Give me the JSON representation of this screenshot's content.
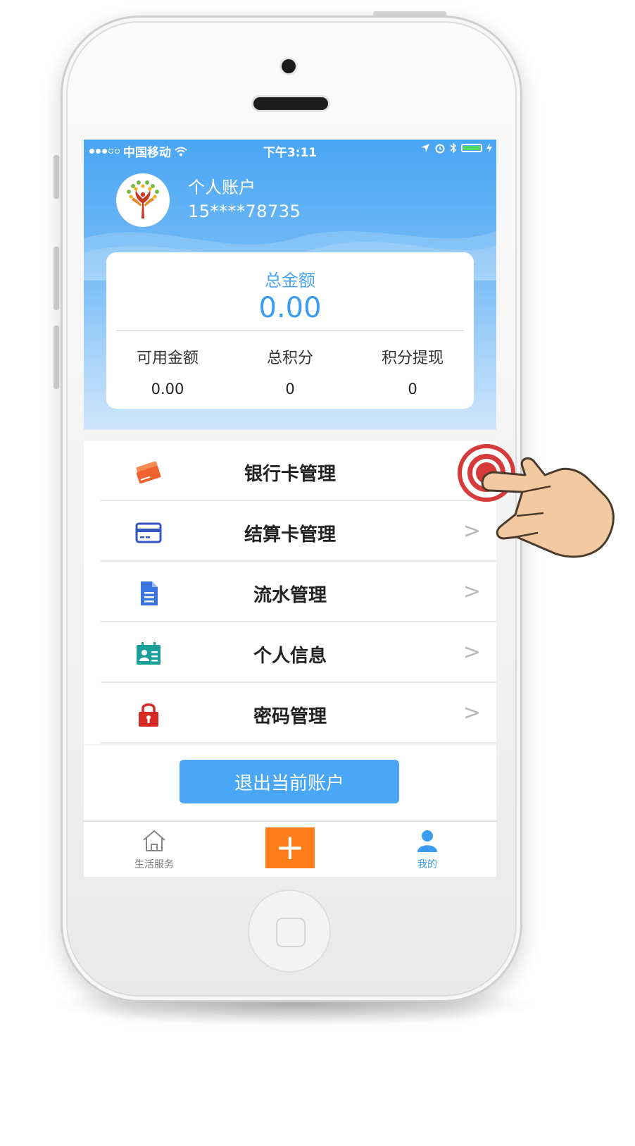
{
  "status_bar": {
    "carrier": "中国移动",
    "time": "下午3:11"
  },
  "account": {
    "title": "个人账户",
    "phone": "15****78735"
  },
  "balance": {
    "total_label": "总金额",
    "total_value": "0.00",
    "stats": [
      {
        "label": "可用金额",
        "value": "0.00"
      },
      {
        "label": "总积分",
        "value": "0"
      },
      {
        "label": "积分提现",
        "value": "0"
      }
    ]
  },
  "menu": {
    "items": [
      {
        "label": "银行卡管理",
        "icon": "bank-card-icon",
        "color": "#f0632e"
      },
      {
        "label": "结算卡管理",
        "icon": "credit-card-icon",
        "color": "#3557c4"
      },
      {
        "label": "流水管理",
        "icon": "document-icon",
        "color": "#3a75e0"
      },
      {
        "label": "个人信息",
        "icon": "id-card-icon",
        "color": "#1a9e9a"
      },
      {
        "label": "密码管理",
        "icon": "lock-icon",
        "color": "#d62b25"
      }
    ],
    "chevron": ">"
  },
  "logout": {
    "label": "退出当前账户"
  },
  "tabbar": {
    "home_label": "生活服务",
    "plus": "+",
    "me_label": "我的"
  },
  "colors": {
    "brand_blue": "#4aa6f6",
    "accent_orange": "#ff7e1a"
  }
}
